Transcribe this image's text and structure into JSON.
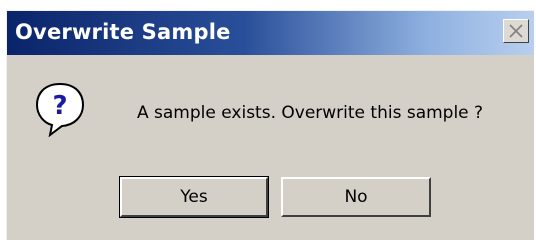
{
  "dialog": {
    "title": "Overwrite Sample",
    "message": "A sample exists. Overwrite this sample ?",
    "icon": "question-icon",
    "buttons": {
      "yes_label": "Yes",
      "no_label": "No"
    },
    "close_icon": "close-icon"
  },
  "colors": {
    "titlebar_start": "#0a246a",
    "titlebar_end": "#b8cfee",
    "dialog_face": "#d4d0c8"
  }
}
